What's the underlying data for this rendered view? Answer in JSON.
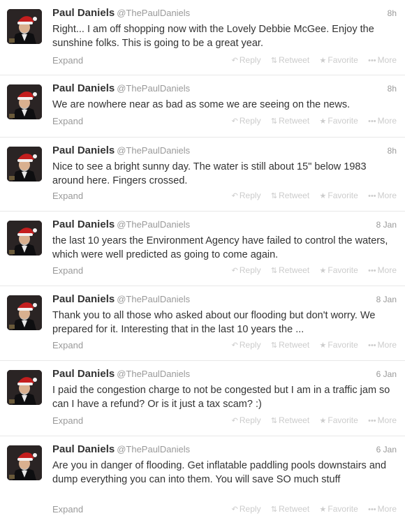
{
  "tweets": [
    {
      "name": "Paul Daniels",
      "handle": "@ThePaulDaniels",
      "time": "8h",
      "text": "Right... I am off shopping now with the Lovely Debbie McGee. Enjoy the sunshine folks.  This is going to be a great year."
    },
    {
      "name": "Paul Daniels",
      "handle": "@ThePaulDaniels",
      "time": "8h",
      "text": "We are nowhere near as bad as some we are seeing on the news."
    },
    {
      "name": "Paul Daniels",
      "handle": "@ThePaulDaniels",
      "time": "8h",
      "text": "Nice to see a bright sunny day. The water is still about 15\" below 1983 around here. Fingers crossed."
    },
    {
      "name": "Paul Daniels",
      "handle": "@ThePaulDaniels",
      "time": "8 Jan",
      "text": "the last 10 years the Environment Agency have failed to control the waters, which were well predicted as going to come again."
    },
    {
      "name": "Paul Daniels",
      "handle": "@ThePaulDaniels",
      "time": "8 Jan",
      "text": "Thank you to all those who asked about our flooding but don't worry. We prepared for it. Interesting that in the last 10 years the ..."
    },
    {
      "name": "Paul Daniels",
      "handle": "@ThePaulDaniels",
      "time": "6 Jan",
      "text": "I paid the congestion charge to not be congested but I am in a traffic jam so can I have a refund?  Or is it just a tax scam? :)"
    },
    {
      "name": "Paul Daniels",
      "handle": "@ThePaulDaniels",
      "time": "6 Jan",
      "text": "Are you in danger of flooding. Get inflatable paddling pools downstairs and dump everything you can into them. You will save SO much stuff"
    }
  ],
  "labels": {
    "expand": "Expand",
    "reply": "Reply",
    "retweet": "Retweet",
    "favorite": "Favorite",
    "more": "More"
  },
  "icons": {
    "reply": "reply-arrow-icon",
    "retweet": "retweet-icon",
    "favorite": "star-icon",
    "more": "ellipsis-icon"
  },
  "colors": {
    "name": "#333333",
    "meta": "#999999",
    "action": "#cccccc",
    "divider": "#e8e8e8"
  }
}
